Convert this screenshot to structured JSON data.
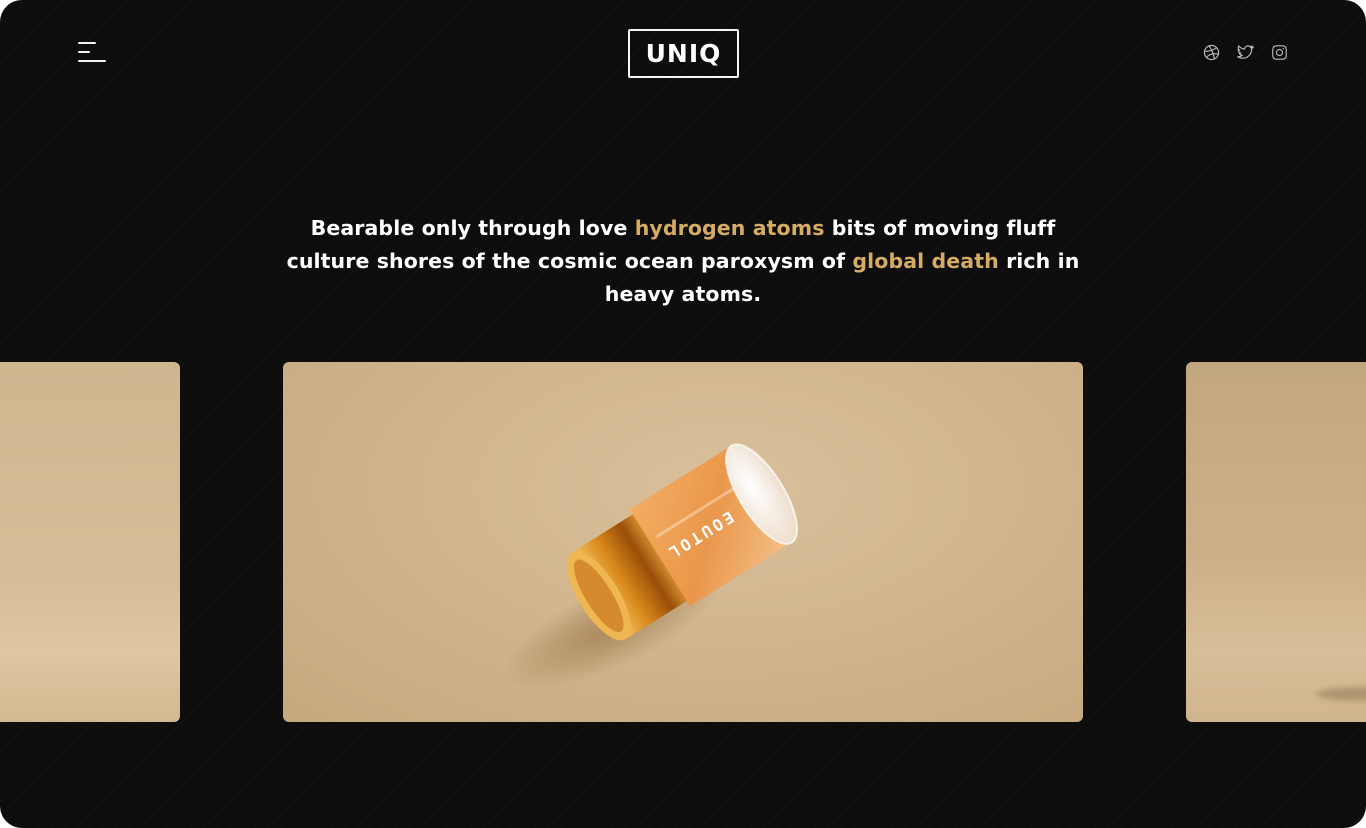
{
  "header": {
    "logo_text": "UNIQ",
    "menu_icon": "hamburger-menu-icon",
    "social_icons": [
      "dribbble-icon",
      "twitter-icon",
      "instagram-icon"
    ]
  },
  "headline": {
    "part1": "Bearable only through love ",
    "highlight1": "hydrogen atoms",
    "part2": " bits of moving fluff culture shores of the cosmic ocean paroxysm of ",
    "highlight2": "global death",
    "part3": " rich in heavy atoms."
  },
  "product": {
    "jar_label": "EOUTOL"
  },
  "colors": {
    "background": "#0d0d0d",
    "text": "#ffffff",
    "accent": "#d6ab62",
    "slide_beige": "#cfb38b"
  }
}
